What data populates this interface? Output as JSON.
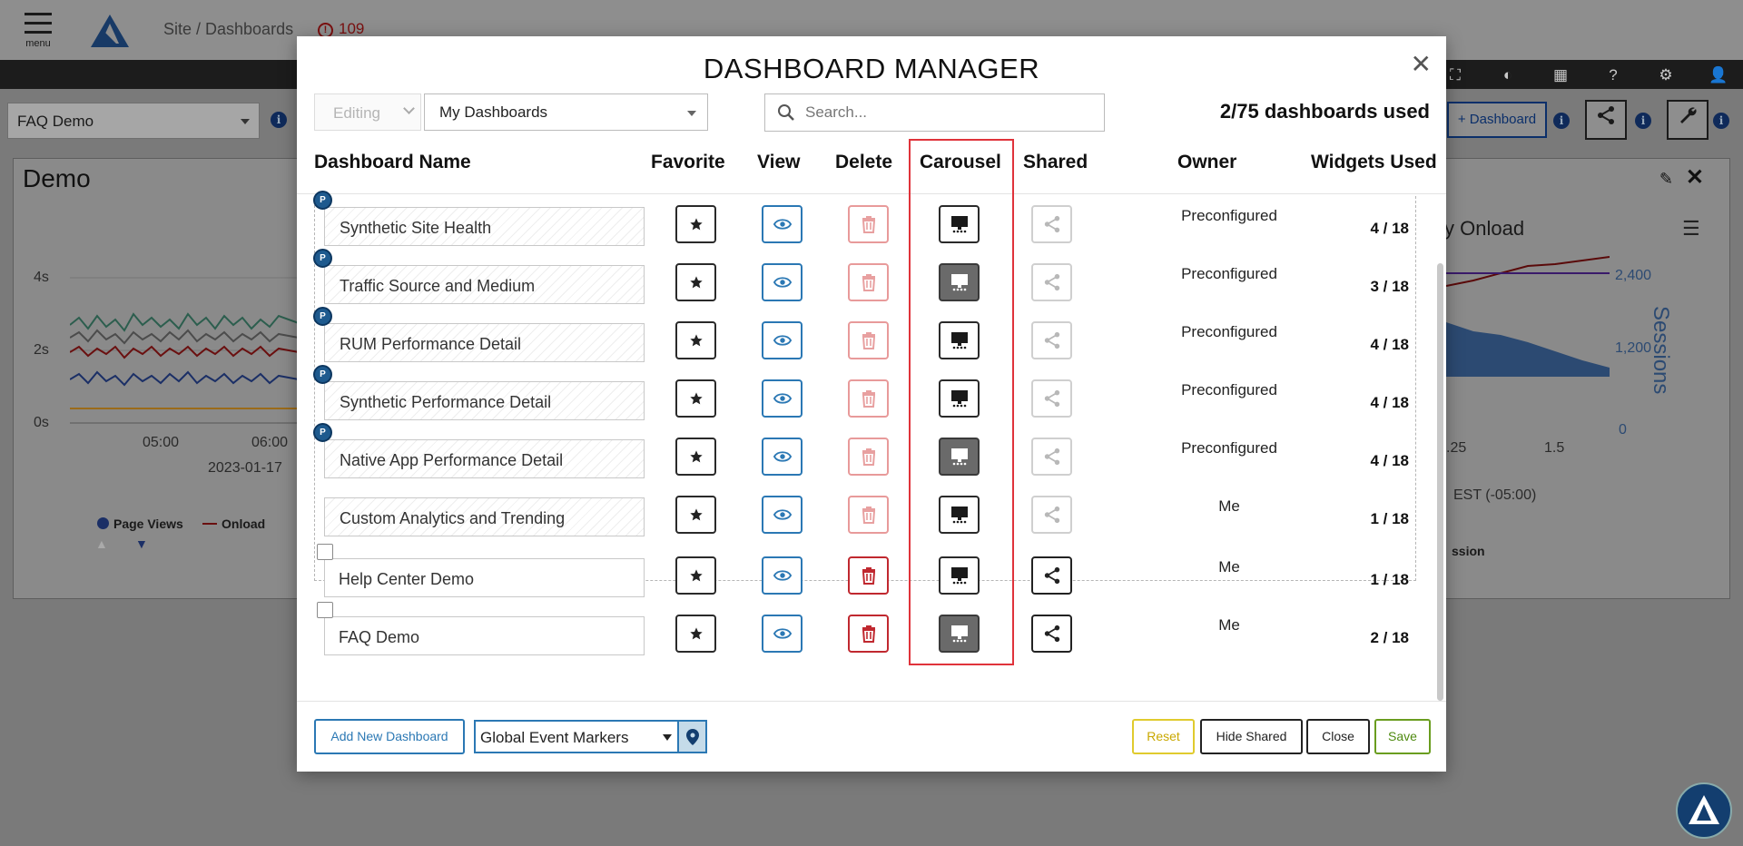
{
  "app": {
    "menu_label": "menu",
    "breadcrumb": "Site / Dashboards",
    "alert_count": "109",
    "dashboard_select": "FAQ Demo",
    "add_dashboard_label": "+ Dashboard",
    "panel_title": "Demo",
    "panel_right_title": "y Onload",
    "y_ticks_left": [
      "4s",
      "2s",
      "0s"
    ],
    "x_ticks_left": [
      "05:00",
      "06:00"
    ],
    "date_label": "2023-01-17",
    "y_ticks_right": [
      "2,400",
      "1,200",
      "0"
    ],
    "x_ticks_right": [
      ".25",
      "1.5"
    ],
    "timezone_label": "EST (-05:00)",
    "right_axis_label": "Sessions",
    "legend": [
      "Page Views",
      "Onload"
    ],
    "legend_right": "ssion"
  },
  "modal": {
    "title": "DASHBOARD MANAGER",
    "mode_select": "Editing",
    "filter_select": "My Dashboards",
    "search_placeholder": "Search...",
    "usage": "2/75 dashboards used",
    "columns": {
      "name": "Dashboard Name",
      "favorite": "Favorite",
      "view": "View",
      "delete": "Delete",
      "carousel": "Carousel",
      "shared": "Shared",
      "owner": "Owner",
      "widgets": "Widgets Used"
    },
    "rows": [
      {
        "name": "Synthetic Site Health",
        "badge": "P",
        "owner": "Preconfigured",
        "widgets": "4 / 18",
        "carousel_on": false,
        "editable": false
      },
      {
        "name": "Traffic Source and Medium",
        "badge": "P",
        "owner": "Preconfigured",
        "widgets": "3 / 18",
        "carousel_on": true,
        "editable": false
      },
      {
        "name": "RUM Performance Detail",
        "badge": "P",
        "owner": "Preconfigured",
        "widgets": "4 / 18",
        "carousel_on": false,
        "editable": false
      },
      {
        "name": "Synthetic Performance Detail",
        "badge": "P",
        "owner": "Preconfigured",
        "widgets": "4 / 18",
        "carousel_on": false,
        "editable": false
      },
      {
        "name": "Native App Performance Detail",
        "badge": "P",
        "owner": "Preconfigured",
        "widgets": "4 / 18",
        "carousel_on": true,
        "editable": false
      },
      {
        "name": "Custom Analytics and Trending",
        "badge": "",
        "owner": "Me",
        "widgets": "1 / 18",
        "carousel_on": false,
        "editable": false
      },
      {
        "name": "Help Center Demo",
        "badge": "",
        "owner": "Me",
        "widgets": "1 / 18",
        "carousel_on": false,
        "editable": true
      },
      {
        "name": "FAQ Demo",
        "badge": "",
        "owner": "Me",
        "widgets": "2 / 18",
        "carousel_on": true,
        "editable": true
      }
    ],
    "footer": {
      "add_new": "Add New Dashboard",
      "event_markers": "Global Event Markers",
      "reset": "Reset",
      "hide_shared": "Hide Shared",
      "close": "Close",
      "save": "Save"
    }
  },
  "colors": {
    "accent_blue": "#2b78b4",
    "delete_red": "#c0282f",
    "highlight_red": "#e0333b",
    "save_green": "#4f8a10",
    "reset_yellow": "#c9a800"
  }
}
